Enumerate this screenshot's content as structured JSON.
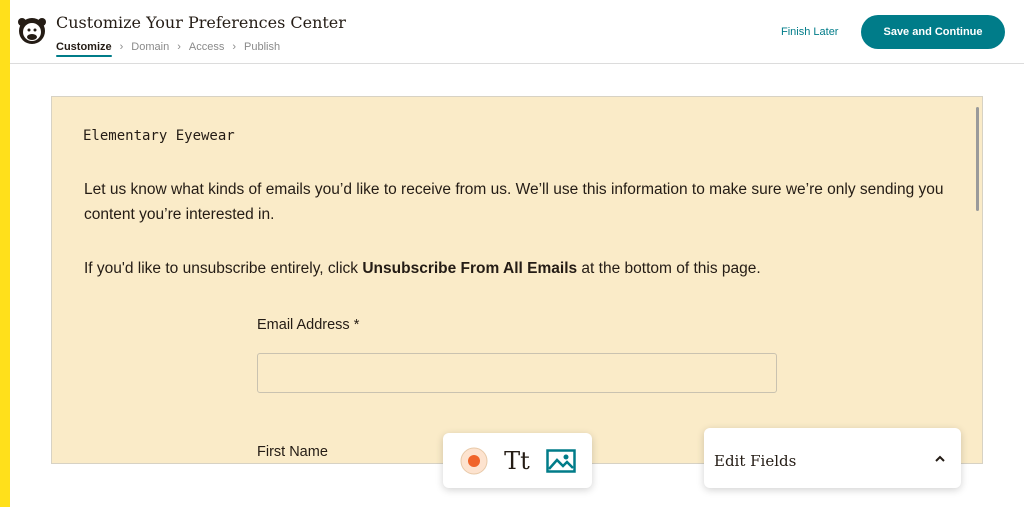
{
  "header": {
    "title": "Customize Your Preferences Center",
    "breadcrumbs": [
      {
        "label": "Customize",
        "active": true
      },
      {
        "label": "Domain",
        "active": false
      },
      {
        "label": "Access",
        "active": false
      },
      {
        "label": "Publish",
        "active": false
      }
    ],
    "finish_later": "Finish Later",
    "save_continue": "Save and Continue"
  },
  "preview": {
    "brand_name": "Elementary Eyewear",
    "intro_text": "Let us know what kinds of emails you’d like to receive from us. We’ll use this information to make sure we’re only sending you content you’re interested in.",
    "unsubscribe_prefix": "If you'd like to unsubscribe entirely, click ",
    "unsubscribe_bold": "Unsubscribe From All Emails",
    "unsubscribe_suffix": " at the bottom of this page.",
    "email_label": "Email Address *",
    "email_value": "",
    "first_name_label": "First Name"
  },
  "toolbar": {
    "icons": [
      "record-icon",
      "text-icon",
      "image-icon"
    ],
    "text_glyph": "Tt"
  },
  "edit_fields": {
    "label": "Edit Fields",
    "icon": "chevron-up-icon"
  },
  "colors": {
    "accent": "#007c89",
    "brand_yellow": "#ffe01b",
    "preview_background": "#faebc8",
    "record_dot": "#f0642a"
  }
}
